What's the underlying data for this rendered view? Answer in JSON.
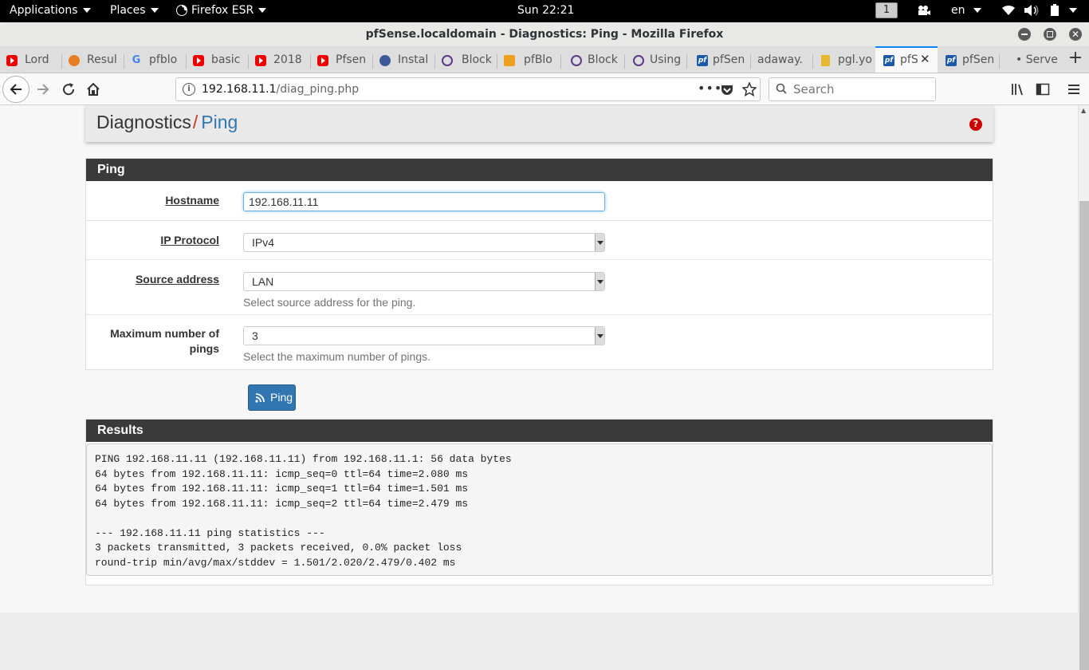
{
  "topbar": {
    "applications": "Applications",
    "places": "Places",
    "firefox": "Firefox ESR",
    "clock": "Sun 22:21",
    "workspace": "1",
    "lang": "en"
  },
  "window": {
    "title": "pfSense.localdomain - Diagnostics: Ping - Mozilla Firefox"
  },
  "tabs": [
    {
      "label": "Lord",
      "icon": "youtube-icon"
    },
    {
      "label": "Resul",
      "icon": "results-icon"
    },
    {
      "label": "pfblo",
      "icon": "google-icon"
    },
    {
      "label": "basic",
      "icon": "youtube-icon"
    },
    {
      "label": "2018",
      "icon": "youtube-icon"
    },
    {
      "label": "Pfsen",
      "icon": "youtube-icon"
    },
    {
      "label": "Instal",
      "icon": "site-icon"
    },
    {
      "label": "Block",
      "icon": "ring-icon"
    },
    {
      "label": "pfBlo",
      "icon": "forum-icon"
    },
    {
      "label": "Block",
      "icon": "ring-icon"
    },
    {
      "label": "Using",
      "icon": "ring-icon"
    },
    {
      "label": "pfSen",
      "icon": "pfsense-icon"
    },
    {
      "label": "adaway.",
      "icon": ""
    },
    {
      "label": "pgl.yo",
      "icon": "file-icon"
    },
    {
      "label": "pfS",
      "icon": "pfsense-icon",
      "active": true
    },
    {
      "label": "pfSen",
      "icon": "pfsense-icon"
    },
    {
      "label": "• Serve",
      "icon": ""
    }
  ],
  "navbar": {
    "url_host": "192.168.11.1",
    "url_path": "/diag_ping.php",
    "search_placeholder": "Search"
  },
  "breadcrumb": {
    "section": "Diagnostics",
    "separator": "/",
    "page": "Ping"
  },
  "form": {
    "panel_title": "Ping",
    "hostname_label": "Hostname",
    "hostname_value": "192.168.11.11",
    "ip_protocol_label": "IP Protocol",
    "ip_protocol_value": "IPv4",
    "source_label": "Source address",
    "source_value": "LAN",
    "source_help": "Select source address for the ping.",
    "maxpings_label_1": "Maximum number of",
    "maxpings_label_2": "pings",
    "maxpings_value": "3",
    "maxpings_help": "Select the maximum number of pings.",
    "submit_label": "Ping"
  },
  "results": {
    "panel_title": "Results",
    "lines": [
      "PING 192.168.11.11 (192.168.11.11) from 192.168.11.1: 56 data bytes",
      "64 bytes from 192.168.11.11: icmp_seq=0 ttl=64 time=2.080 ms",
      "64 bytes from 192.168.11.11: icmp_seq=1 ttl=64 time=1.501 ms",
      "64 bytes from 192.168.11.11: icmp_seq=2 ttl=64 time=2.479 ms",
      "",
      "--- 192.168.11.11 ping statistics ---",
      "3 packets transmitted, 3 packets received, 0.0% packet loss",
      "round-trip min/avg/max/stddev = 1.501/2.020/2.479/0.402 ms"
    ]
  },
  "colors": {
    "accent": "#3276b1",
    "panel_header": "#3a3a3a",
    "breadcrumb_separator": "#c0392b",
    "tab_active": "#0a84ff"
  }
}
